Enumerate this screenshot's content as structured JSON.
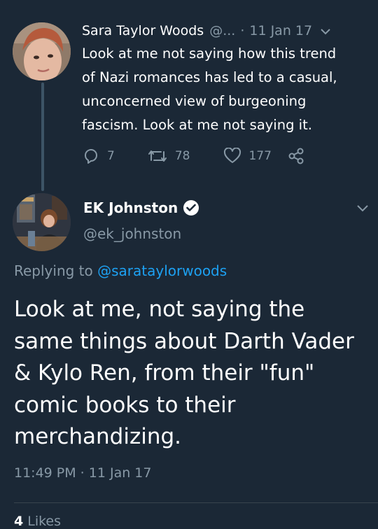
{
  "parent_tweet": {
    "display_name": "Sara Taylor Woods",
    "handle_truncated": "@...",
    "separator": "·",
    "date": "11 Jan 17",
    "text_lines": [
      "Look at me not saying how this trend",
      "of Nazi romances has led to a casual,",
      "unconcerned view of burgeoning",
      "fascism. Look at me not saying it."
    ],
    "reply_count": "7",
    "retweet_count": "78",
    "like_count": "177"
  },
  "tweet": {
    "display_name": "EK Johnston",
    "handle": "@ek_johnston",
    "replying_prefix": "Replying to",
    "replying_to": "@sarataylorwoods",
    "text_lines": [
      "Look at me, not saying the",
      "same things about Darth Vader",
      "& Kylo Ren, from their \"fun\"",
      "comic books to their",
      "merchandizing."
    ],
    "timestamp": "11:49 PM · 11 Jan 17",
    "likes_count": "4",
    "likes_label": "Likes"
  },
  "icons": {
    "reply": "reply-icon",
    "retweet": "retweet-icon",
    "like": "heart-icon",
    "share": "share-icon",
    "caret": "chevron-down-icon",
    "verified": "verified-badge-icon"
  },
  "colors": {
    "background": "#1b2836",
    "secondary_text": "#8899a6",
    "link": "#1da1f2",
    "thread_line": "#3d5466"
  }
}
